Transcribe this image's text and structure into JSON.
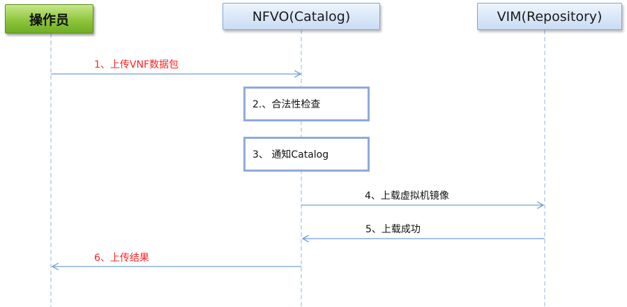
{
  "actors": {
    "operator": "操作员",
    "nfvo": "NFVO(Catalog)",
    "vim": "VIM(Repository)"
  },
  "steps": {
    "upload_package": "1、上传VNF数据包",
    "legality_check": "2.、合法性检查",
    "notify_catalog": "3、 通知Catalog",
    "upload_image": "4、上载虚拟机镜像",
    "upload_success": "5、上载成功",
    "upload_result": "6、上传结果"
  },
  "colors": {
    "operator_fill": "#8fc63d",
    "node_fill": "#c9dcf5",
    "arrow": "#6f9fd8",
    "lifeline": "#8fb5de",
    "highlight_text": "#ff2020"
  }
}
